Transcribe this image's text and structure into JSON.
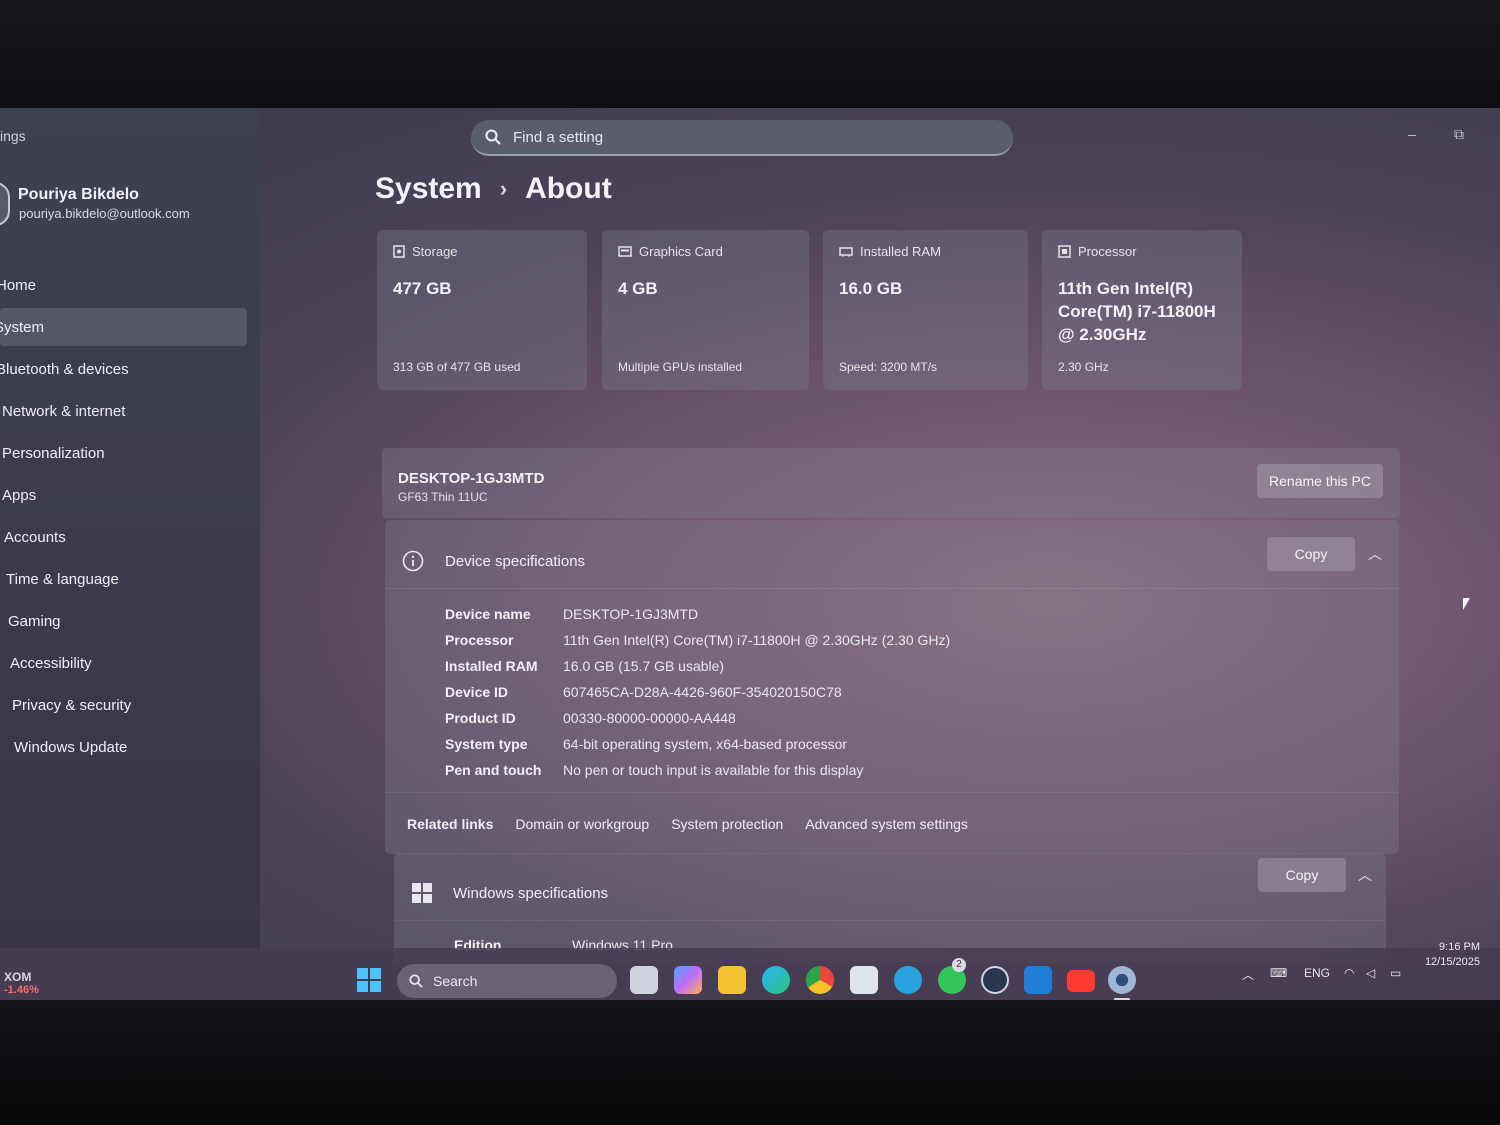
{
  "app_title": "ings",
  "user": {
    "name": "Pouriya Bikdelo",
    "email": "pouriya.bikdelo@outlook.com"
  },
  "search": {
    "placeholder": "Find a setting"
  },
  "window_controls": {
    "minimize": "–",
    "restore": "⧉"
  },
  "nav": [
    {
      "label": "Home"
    },
    {
      "label": "System"
    },
    {
      "label": "Bluetooth & devices"
    },
    {
      "label": "Network & internet"
    },
    {
      "label": "Personalization"
    },
    {
      "label": "Apps"
    },
    {
      "label": "Accounts"
    },
    {
      "label": "Time & language"
    },
    {
      "label": "Gaming"
    },
    {
      "label": "Accessibility"
    },
    {
      "label": "Privacy & security"
    },
    {
      "label": "Windows Update"
    }
  ],
  "breadcrumb": {
    "parent": "System",
    "separator": "›",
    "current": "About"
  },
  "cards": [
    {
      "title": "Storage",
      "value": "477 GB",
      "sub": "313 GB of 477 GB used"
    },
    {
      "title": "Graphics Card",
      "value": "4 GB",
      "sub": "Multiple GPUs installed"
    },
    {
      "title": "Installed RAM",
      "value": "16.0 GB",
      "sub": "Speed: 3200 MT/s"
    },
    {
      "title": "Processor",
      "value": "11th Gen Intel(R) Core(TM) i7-11800H @ 2.30GHz",
      "sub": "2.30 GHz"
    }
  ],
  "pc": {
    "name": "DESKTOP-1GJ3MTD",
    "model": "GF63 Thin 11UC",
    "rename_label": "Rename this PC"
  },
  "device_specs": {
    "title": "Device specifications",
    "copy_label": "Copy",
    "rows": [
      {
        "key": "Device name",
        "value": "DESKTOP-1GJ3MTD"
      },
      {
        "key": "Processor",
        "value": "11th Gen Intel(R) Core(TM) i7-11800H @ 2.30GHz (2.30 GHz)"
      },
      {
        "key": "Installed RAM",
        "value": "16.0 GB (15.7 GB usable)"
      },
      {
        "key": "Device ID",
        "value": "607465CA-D28A-4426-960F-354020150C78"
      },
      {
        "key": "Product ID",
        "value": "00330-80000-00000-AA448"
      },
      {
        "key": "System type",
        "value": "64-bit operating system, x64-based processor"
      },
      {
        "key": "Pen and touch",
        "value": "No pen or touch input is available for this display"
      }
    ]
  },
  "related_links": {
    "label": "Related links",
    "links": [
      "Domain or workgroup",
      "System protection",
      "Advanced system settings"
    ]
  },
  "windows_specs": {
    "title": "Windows specifications",
    "copy_label": "Copy",
    "rows": [
      {
        "key": "Edition",
        "value": "Windows 11 Pro"
      }
    ]
  },
  "taskbar": {
    "search_label": "Search",
    "stock": {
      "symbol": "XOM",
      "change": "-1.46%"
    },
    "language": "ENG",
    "time": "9:16 PM",
    "date": "12/15/2025",
    "notification_badge": "2"
  },
  "colors": {
    "accent": "#0a84d8",
    "stock_down": "#ff6b6b"
  }
}
